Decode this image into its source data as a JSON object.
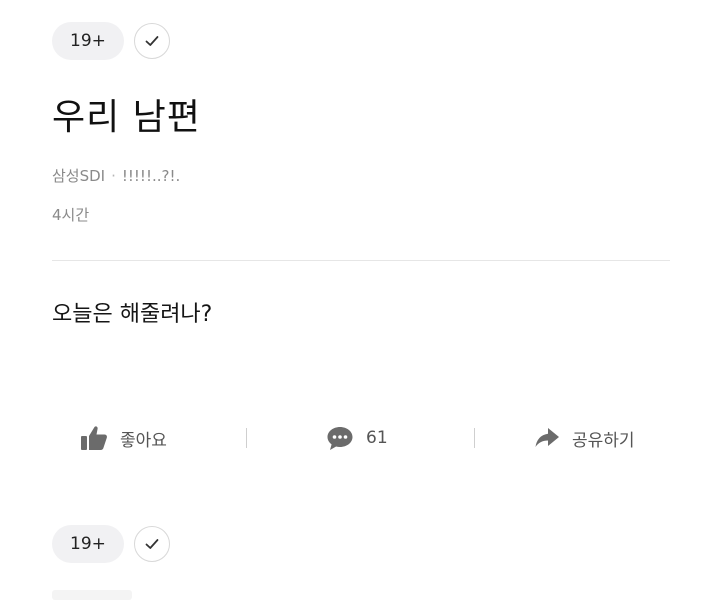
{
  "post": {
    "age_badge": "19+",
    "title": "우리 남편",
    "company": "삼성SDI",
    "meta_separator": "·",
    "nickname": "!!!!!..?!.",
    "time": "4시간",
    "body": "오늘은 해줄려나?"
  },
  "actions": {
    "like_label": "좋아요",
    "comment_count": "61",
    "share_label": "공유하기"
  },
  "next_post": {
    "age_badge": "19+"
  },
  "icons": {
    "verified": "check-icon",
    "like": "thumbs-up-icon",
    "comment": "speech-bubble-icon",
    "share": "share-arrow-icon"
  },
  "colors": {
    "icon_gray": "#6b6b6b",
    "badge_bg": "#f1f1f3",
    "meta_text": "#8a8a8a"
  }
}
